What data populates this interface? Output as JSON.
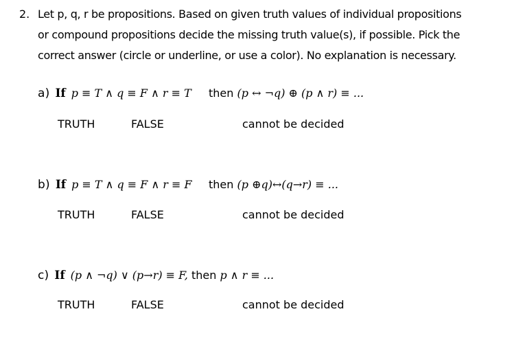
{
  "question": {
    "number": "2.",
    "intro_lines": [
      "Let p, q, r be propositions. Based on given truth values of individual propositions",
      "or compound propositions decide the missing truth value(s), if possible. Pick the",
      "correct answer (circle or underline, or use a color). No explanation is necessary."
    ]
  },
  "parts": [
    {
      "label": "a)",
      "if_word": "If",
      "condition": "p ≡ T ∧ q ≡ F ∧ r ≡ T",
      "then_word": "then",
      "expression": "(p ↔ ¬q) ⊕ (p ∧ r) ≡ ...",
      "options": [
        "TRUTH",
        "FALSE",
        "cannot be decided"
      ]
    },
    {
      "label": "b)",
      "if_word": "If",
      "condition": "p ≡ T ∧ q ≡ F ∧ r ≡ F",
      "then_word": "then",
      "expression": "(p ⊕q)↔(q→r) ≡ ...",
      "options": [
        "TRUTH",
        "FALSE",
        "cannot be decided"
      ]
    },
    {
      "label": "c)",
      "if_word": "If",
      "condition": "(p ∧ ¬q) ∨ (p→r) ≡ F,",
      "then_word": "then",
      "expression": "p ∧ r ≡ ...",
      "options": [
        "TRUTH",
        "FALSE",
        "cannot be decided"
      ]
    }
  ]
}
